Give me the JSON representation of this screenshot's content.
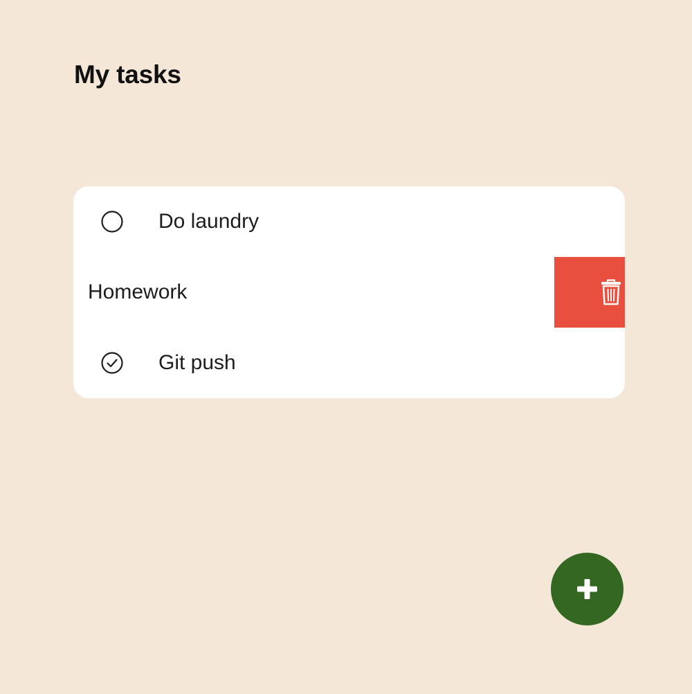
{
  "header": {
    "title": "My tasks"
  },
  "tasks": [
    {
      "label": "Do laundry",
      "status": "unchecked",
      "icon": "circle-outline-icon"
    },
    {
      "label": "Homework",
      "status": "swiped",
      "action_icon": "trash-icon"
    },
    {
      "label": "Git push",
      "status": "checked",
      "icon": "check-circle-icon"
    }
  ],
  "fab": {
    "icon": "plus-icon"
  },
  "colors": {
    "background": "#f5e7d8",
    "card": "#ffffff",
    "delete": "#e94f3e",
    "fab": "#336722",
    "text": "#1d1d1d"
  }
}
